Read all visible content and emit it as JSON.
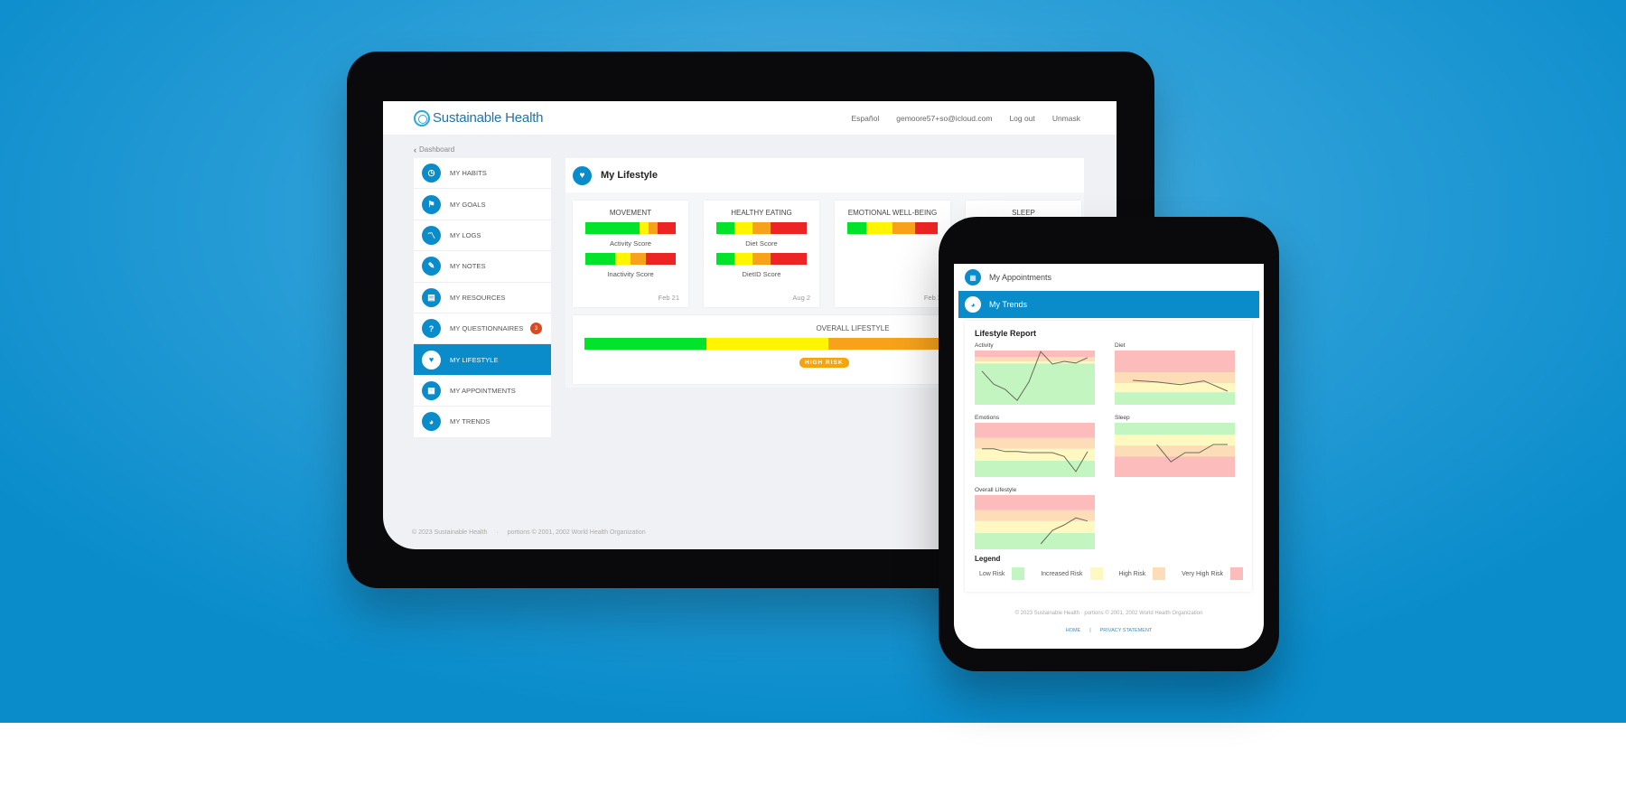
{
  "colors": {
    "accent": "#0a8ccb",
    "risk_green": "#00e32a",
    "risk_yellow": "#fff500",
    "risk_orange": "#f7a21a",
    "risk_red": "#ec2424",
    "band_green": "#c2f5c0",
    "band_yellow": "#fff8c0",
    "band_orange": "#fddcb8",
    "band_red": "#fdbcbc",
    "badge": "#e0471c"
  },
  "desktop": {
    "brand": "Sustainable Health",
    "top_links": [
      "Español",
      "gemoore57+so@icloud.com",
      "Log out",
      "Unmask"
    ],
    "breadcrumb": "Dashboard",
    "sidebar": [
      {
        "label": "MY HABITS",
        "icon": "clock-icon",
        "glyph": "◷"
      },
      {
        "label": "MY GOALS",
        "icon": "flag-icon",
        "glyph": "⚑"
      },
      {
        "label": "MY LOGS",
        "icon": "chart-line-icon",
        "glyph": "〽"
      },
      {
        "label": "MY NOTES",
        "icon": "pencil-icon",
        "glyph": "✎"
      },
      {
        "label": "MY RESOURCES",
        "icon": "document-icon",
        "glyph": "▤"
      },
      {
        "label": "MY QUESTIONNAIRES",
        "icon": "question-icon",
        "glyph": "?",
        "badge": "3"
      },
      {
        "label": "MY LIFESTYLE",
        "icon": "heart-icon",
        "glyph": "♥",
        "active": true
      },
      {
        "label": "MY APPOINTMENTS",
        "icon": "calendar-icon",
        "glyph": "▦"
      },
      {
        "label": "MY TRENDS",
        "icon": "trends-icon",
        "glyph": "◕"
      }
    ],
    "main_title": "My Lifestyle",
    "cards": [
      {
        "title": "MOVEMENT",
        "date": "Feb 21",
        "scores": [
          {
            "label": "Activity Score",
            "segments": [
              0.6,
              0.1,
              0.1,
              0.2
            ]
          },
          {
            "label": "Inactivity Score",
            "segments": [
              0.33,
              0.17,
              0.17,
              0.33
            ]
          }
        ]
      },
      {
        "title": "HEALTHY EATING",
        "date": "Aug 2",
        "scores": [
          {
            "label": "Diet Score",
            "segments": [
              0.2,
              0.2,
              0.2,
              0.4
            ]
          },
          {
            "label": "DietID Score",
            "segments": [
              0.2,
              0.2,
              0.2,
              0.4
            ]
          }
        ]
      },
      {
        "title": "EMOTIONAL WELL-BEING",
        "date": "Feb 2",
        "scores": [
          {
            "label": "",
            "segments": [
              0.21,
              0.29,
              0.25,
              0.25
            ]
          }
        ]
      },
      {
        "title": "SLEEP",
        "date": "",
        "scores": []
      }
    ],
    "overall": {
      "title": "OVERALL LIFESTYLE",
      "segments": [
        0.25,
        0.25,
        0.25,
        0.25
      ],
      "risk_label": "HIGH RISK"
    },
    "footer": [
      "© 2023 Sustainable Health",
      "portions © 2001, 2002 World Health Organization"
    ]
  },
  "mobile": {
    "nav": [
      {
        "label": "My Appointments",
        "icon": "calendar-icon",
        "glyph": "▦"
      },
      {
        "label": "My Trends",
        "icon": "trends-icon",
        "glyph": "◕",
        "active": true
      }
    ],
    "report_title": "Lifestyle Report",
    "charts": [
      {
        "label": "Activity",
        "bands": [
          "red",
          "orange",
          "yellow",
          "green"
        ],
        "band_fracs": [
          0.12,
          0.08,
          0.04,
          0.76
        ],
        "values": [
          0.62,
          0.38,
          0.28,
          0.08,
          0.42,
          0.98,
          0.75,
          0.8,
          0.77,
          0.87
        ]
      },
      {
        "label": "Diet",
        "bands": [
          "red",
          "orange",
          "yellow",
          "green"
        ],
        "band_fracs": [
          0.4,
          0.2,
          0.17,
          0.23
        ],
        "values": [
          0.45,
          0.42,
          0.37,
          0.44,
          0.25
        ]
      },
      {
        "label": "Emotions",
        "bands": [
          "red",
          "orange",
          "yellow",
          "green"
        ],
        "band_fracs": [
          0.28,
          0.2,
          0.22,
          0.3
        ],
        "values": [
          0.52,
          0.52,
          0.47,
          0.47,
          0.45,
          0.45,
          0.45,
          0.38,
          0.1,
          0.47
        ]
      },
      {
        "label": "Sleep",
        "bands": [
          "green",
          "yellow",
          "orange",
          "red"
        ],
        "band_fracs": [
          0.22,
          0.2,
          0.2,
          0.38
        ],
        "values": [
          0.6,
          0.28,
          0.45,
          0.45,
          0.6,
          0.6
        ]
      },
      {
        "label": "Overall Lifestyle",
        "bands": [
          "red",
          "orange",
          "yellow",
          "green"
        ],
        "band_fracs": [
          0.28,
          0.2,
          0.22,
          0.3
        ],
        "values": [
          0.1,
          0.35,
          0.45,
          0.58,
          0.52
        ]
      }
    ],
    "legend_title": "Legend",
    "legend": [
      {
        "label": "Low Risk",
        "color": "band_green"
      },
      {
        "label": "Increased Risk",
        "color": "band_yellow"
      },
      {
        "label": "High Risk",
        "color": "band_orange"
      },
      {
        "label": "Very High Risk",
        "color": "band_red"
      }
    ],
    "footer": "© 2023 Sustainable Health  ·  portions © 2001, 2002 World Health Organization",
    "links": [
      "HOME",
      "PRIVACY STATEMENT"
    ]
  }
}
